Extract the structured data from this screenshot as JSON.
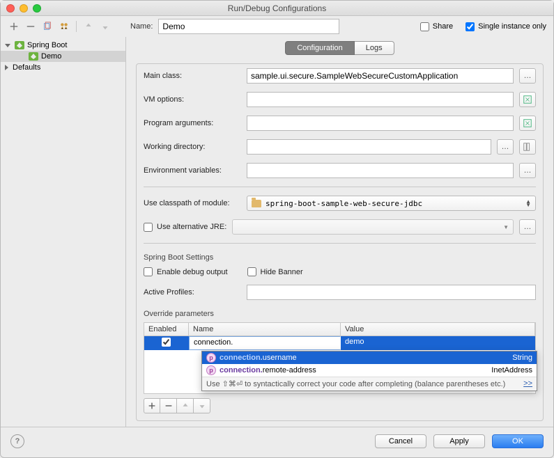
{
  "window": {
    "title": "Run/Debug Configurations"
  },
  "name_field": {
    "label": "Name:",
    "value": "Demo"
  },
  "share": {
    "label": "Share",
    "checked": false
  },
  "single_instance": {
    "label": "Single instance only",
    "checked": true
  },
  "tree": {
    "root": "Spring Boot",
    "selected": "Demo",
    "group2": "Defaults"
  },
  "tabs": {
    "config": "Configuration",
    "logs": "Logs"
  },
  "fields": {
    "main_class_label": "Main class:",
    "main_class_value": "sample.ui.secure.SampleWebSecureCustomApplication",
    "vm_label": "VM options:",
    "vm_value": "",
    "args_label": "Program arguments:",
    "args_value": "",
    "workdir_label": "Working directory:",
    "workdir_value": "",
    "env_label": "Environment variables:",
    "env_value": "",
    "classpath_label": "Use classpath of module:",
    "classpath_value": "spring-boot-sample-web-secure-jdbc",
    "altjre_label": "Use alternative JRE:",
    "altjre_value": ""
  },
  "spring_section": {
    "title": "Spring Boot Settings",
    "debug_label": "Enable debug output",
    "hide_banner_label": "Hide Banner",
    "profiles_label": "Active Profiles:",
    "profiles_value": ""
  },
  "override": {
    "title": "Override parameters",
    "col_enabled": "Enabled",
    "col_name": "Name",
    "col_value": "Value",
    "row_name": "connection.",
    "row_value": "demo"
  },
  "autocomplete": {
    "item1_prefix": "connection.",
    "item1_rest": "username",
    "item1_type": "String",
    "item2_prefix": "connection.",
    "item2_rest": "remote-address",
    "item2_type": "InetAddress",
    "hint": "Use ⇧⌘⏎ to syntactically correct your code after completing (balance parentheses etc.)",
    "more": ">>"
  },
  "footer": {
    "cancel": "Cancel",
    "apply": "Apply",
    "ok": "OK"
  }
}
